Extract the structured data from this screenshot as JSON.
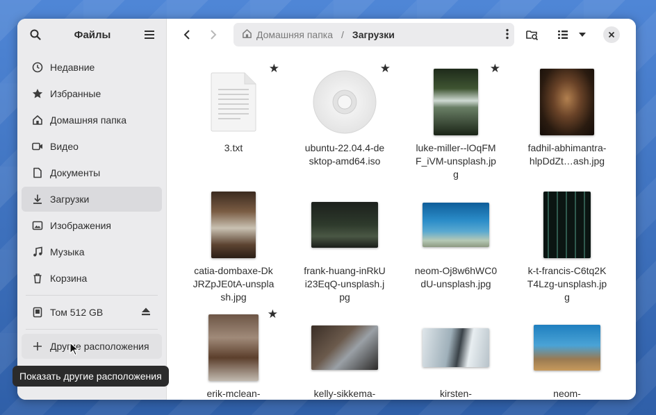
{
  "sidebar": {
    "title": "Файлы",
    "items": [
      {
        "label": "Недавние",
        "icon": "clock-icon"
      },
      {
        "label": "Избранные",
        "icon": "star-icon"
      },
      {
        "label": "Домашняя папка",
        "icon": "home-icon"
      },
      {
        "label": "Видео",
        "icon": "video-icon"
      },
      {
        "label": "Документы",
        "icon": "document-icon"
      },
      {
        "label": "Загрузки",
        "icon": "download-icon",
        "active": true
      },
      {
        "label": "Изображения",
        "icon": "image-icon"
      },
      {
        "label": "Музыка",
        "icon": "music-icon"
      },
      {
        "label": "Корзина",
        "icon": "trash-icon"
      }
    ],
    "volume": {
      "label": "Том 512 GB",
      "icon": "drive-icon",
      "eject_icon": "eject-icon"
    },
    "other_locations": "Другие расположения"
  },
  "toolbar": {
    "path": {
      "home": "Домашняя папка",
      "separator": "/",
      "current": "Загрузки"
    }
  },
  "files": [
    {
      "name": "3.txt",
      "starred": true,
      "kind": "text"
    },
    {
      "name": "ubuntu-22.04.4-desktop-amd64.iso",
      "starred": true,
      "kind": "disc"
    },
    {
      "name": "luke-miller--lOqFMF_iVM-unsplash.jpg",
      "starred": true,
      "kind": "photo"
    },
    {
      "name": "fadhil-abhimantra-hlpDdZt…ash.jpg",
      "starred": false,
      "kind": "photo"
    },
    {
      "name": "catia-dombaxe-DkJRZpJE0tA-unsplash.jpg",
      "starred": false,
      "kind": "photo"
    },
    {
      "name": "frank-huang-inRkUi23EqQ-unsplash.jpg",
      "starred": false,
      "kind": "photo"
    },
    {
      "name": "neom-Oj8w6hWC0dU-unsplash.jpg",
      "starred": false,
      "kind": "photo"
    },
    {
      "name": "k-t-francis-C6tq2KT4Lzg-unsplash.jpg",
      "starred": false,
      "kind": "photo"
    },
    {
      "name": "erik-mclean-",
      "starred": true,
      "kind": "photo"
    },
    {
      "name": "kelly-sikkema-",
      "starred": false,
      "kind": "photo"
    },
    {
      "name": "kirsten-",
      "starred": false,
      "kind": "photo"
    },
    {
      "name": "neom-",
      "starred": false,
      "kind": "photo"
    }
  ],
  "tooltip": "Показать другие расположения",
  "colors": {
    "accent": "#3584e4",
    "sidebar_bg": "#ebebed",
    "active_item": "#dadadd"
  }
}
